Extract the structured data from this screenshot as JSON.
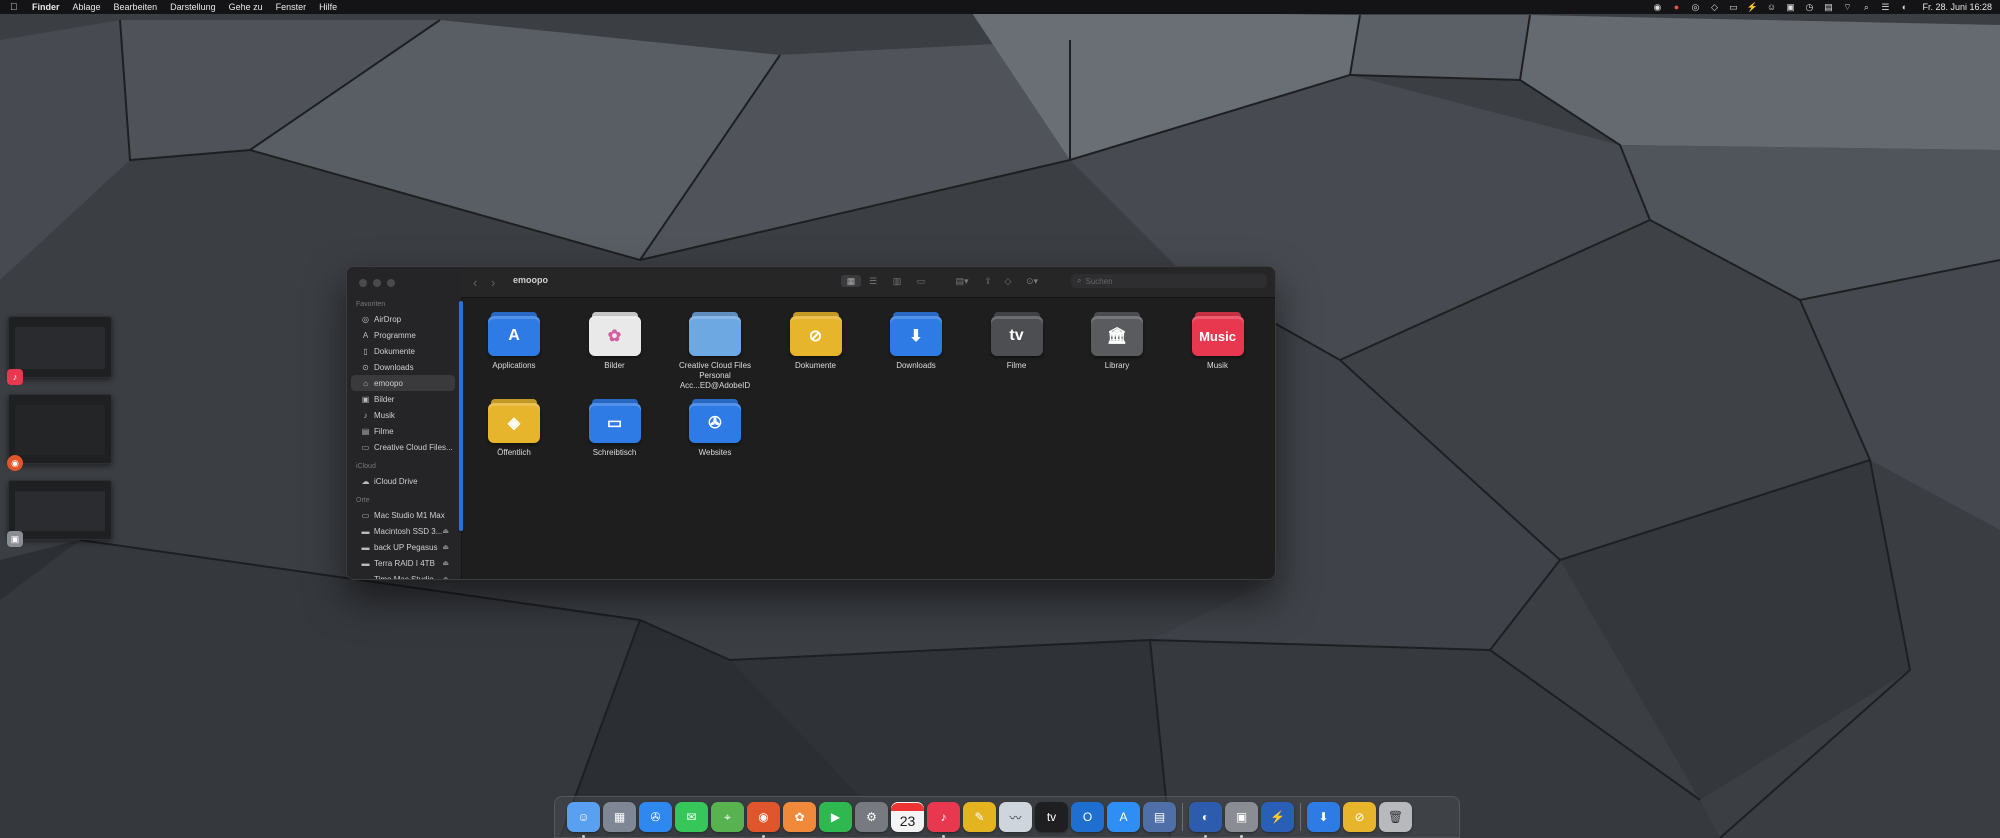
{
  "menubar": {
    "apple_icon": "apple-icon",
    "items": [
      "Finder",
      "Ablage",
      "Bearbeiten",
      "Darstellung",
      "Gehe zu",
      "Fenster",
      "Hilfe"
    ],
    "status_icons": [
      "creative-cloud-icon",
      "record-icon",
      "broadcast-icon",
      "diamond-icon",
      "display-icon",
      "bolt-icon",
      "user-icon",
      "lock-icon",
      "history-icon",
      "calendar-icon",
      "wifi-icon",
      "search-icon",
      "control-center-icon",
      "siri-icon"
    ],
    "clock": "Fr. 28. Juni 16:28"
  },
  "finder": {
    "title": "emoopo",
    "search_placeholder": "Suchen",
    "sidebar": {
      "favorites_header": "Favoriten",
      "favorites": [
        {
          "label": "AirDrop",
          "icon": "airdrop-icon"
        },
        {
          "label": "Programme",
          "icon": "applications-icon"
        },
        {
          "label": "Dokumente",
          "icon": "document-icon"
        },
        {
          "label": "Downloads",
          "icon": "download-icon"
        },
        {
          "label": "emoopo",
          "icon": "home-icon"
        },
        {
          "label": "Bilder",
          "icon": "pictures-icon"
        },
        {
          "label": "Musik",
          "icon": "music-icon"
        },
        {
          "label": "Filme",
          "icon": "film-icon"
        },
        {
          "label": "Creative Cloud Files...",
          "icon": "folder-icon"
        }
      ],
      "icloud_header": "iCloud",
      "icloud": [
        {
          "label": "iCloud Drive",
          "icon": "cloud-icon"
        }
      ],
      "locations_header": "Orte",
      "locations": [
        {
          "label": "Mac Studio M1 Max",
          "icon": "computer-icon"
        },
        {
          "label": "Macintosh SSD 3...",
          "icon": "disk-icon"
        },
        {
          "label": "back UP Pegasus",
          "icon": "disk-icon"
        },
        {
          "label": "Terra RAID I 4TB",
          "icon": "disk-icon"
        },
        {
          "label": "Time Mac Studio",
          "icon": "disk-icon"
        }
      ]
    },
    "items": [
      {
        "label": "Applications",
        "label2": "",
        "glyph": "A",
        "color": "#2f7be6",
        "name": "applications-folder"
      },
      {
        "label": "Bilder",
        "label2": "",
        "glyph": "✿",
        "color": "#e9e9ea",
        "name": "pictures-folder"
      },
      {
        "label": "Creative Cloud Files",
        "label2": "Personal Acc...ED@AdobeID",
        "glyph": "",
        "color": "#6ea8e2",
        "name": "creative-cloud-folder"
      },
      {
        "label": "Dokumente",
        "label2": "",
        "glyph": "⊘",
        "color": "#e7b52c",
        "name": "documents-folder"
      },
      {
        "label": "Downloads",
        "label2": "",
        "glyph": "⬇",
        "color": "#2f7be6",
        "name": "downloads-folder"
      },
      {
        "label": "Filme",
        "label2": "",
        "glyph": "tv",
        "color": "#4d4e52",
        "name": "movies-folder"
      },
      {
        "label": "Library",
        "label2": "",
        "glyph": "🏛",
        "color": "#5a5b5f",
        "name": "library-folder"
      },
      {
        "label": "Musik",
        "label2": "",
        "glyph": "Music",
        "color": "#e8384f",
        "name": "music-folder"
      },
      {
        "label": "Öffentlich",
        "label2": "",
        "glyph": "◈",
        "color": "#e7b52c",
        "name": "public-folder"
      },
      {
        "label": "Schreibtisch",
        "label2": "",
        "glyph": "▭",
        "color": "#2f7be6",
        "name": "desktop-folder"
      },
      {
        "label": "Websites",
        "label2": "",
        "glyph": "✇",
        "color": "#2f7be6",
        "name": "websites-folder"
      }
    ]
  },
  "dock": {
    "calendar_day": "23",
    "apps": [
      {
        "name": "finder",
        "color": "#5aa0f0",
        "glyph": "☺"
      },
      {
        "name": "launchpad",
        "color": "#7f8794",
        "glyph": "▦"
      },
      {
        "name": "safari",
        "color": "#2e88f0",
        "glyph": "✇"
      },
      {
        "name": "messages",
        "color": "#37c659",
        "glyph": "✉"
      },
      {
        "name": "maps",
        "color": "#58b24f",
        "glyph": "⌖"
      },
      {
        "name": "firefox",
        "color": "#e0552b",
        "glyph": "◉"
      },
      {
        "name": "photos",
        "color": "#f08a3a",
        "glyph": "✿"
      },
      {
        "name": "facetime",
        "color": "#2fb84f",
        "glyph": "▶"
      },
      {
        "name": "system-settings",
        "color": "#777a80",
        "glyph": "⚙"
      },
      {
        "name": "calendar",
        "color": "#f4f4f4",
        "glyph": ""
      },
      {
        "name": "music",
        "color": "#e8384f",
        "glyph": "♪"
      },
      {
        "name": "final-draft",
        "color": "#e3b320",
        "glyph": "✎"
      },
      {
        "name": "activity-monitor",
        "color": "#cfd5dd",
        "glyph": "〰"
      },
      {
        "name": "apple-tv",
        "color": "#1f1f22",
        "glyph": "tv"
      },
      {
        "name": "outlook",
        "color": "#1f6fd1",
        "glyph": "O"
      },
      {
        "name": "app-store",
        "color": "#2f8ef4",
        "glyph": "A"
      },
      {
        "name": "keynote-grid",
        "color": "#4f6fa8",
        "glyph": "▤"
      },
      {
        "name": "separator",
        "color": "",
        "glyph": ""
      },
      {
        "name": "preview",
        "color": "#2d5cae",
        "glyph": "◐"
      },
      {
        "name": "image-capture",
        "color": "#8a8d93",
        "glyph": "▣"
      },
      {
        "name": "bolt-app",
        "color": "#2a5fb8",
        "glyph": "⚡"
      },
      {
        "name": "separator",
        "color": "",
        "glyph": ""
      },
      {
        "name": "downloads-stack",
        "color": "#2f7be6",
        "glyph": "⬇"
      },
      {
        "name": "documents-stack",
        "color": "#e7b52c",
        "glyph": "⊘"
      },
      {
        "name": "trash",
        "color": "#b7b9bd",
        "glyph": "🗑"
      }
    ]
  }
}
